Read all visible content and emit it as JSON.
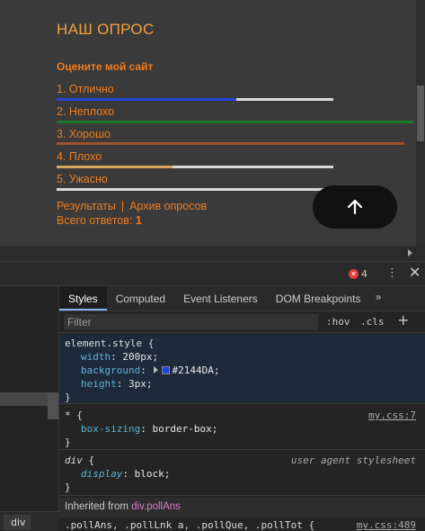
{
  "poll": {
    "title": "НАШ ОПРОС",
    "question": "Оцените мой сайт",
    "answers": [
      {
        "label": "1. Отлично",
        "fraction": 0.65,
        "color": "#2144DA"
      },
      {
        "label": "2. Неплохо",
        "fraction": 1.0,
        "color": "#1a7a2a"
      },
      {
        "label": "3. Хорошо",
        "fraction": 1.0,
        "color": "#a0522d"
      },
      {
        "label": "4. Плохо",
        "fraction": 0.42,
        "color": "#d9a55a"
      },
      {
        "label": "5. Ужасно",
        "fraction": 0.0,
        "color": "#d8d8d8"
      }
    ],
    "results_link": "Результаты",
    "separator": "|",
    "archive_link": "Архив опросов",
    "total_label": "Всего ответов: ",
    "total_value": "1"
  },
  "devtools": {
    "error_count": "4",
    "tabs": [
      "Styles",
      "Computed",
      "Event Listeners",
      "DOM Breakpoints"
    ],
    "more_tabs": "»",
    "filter_placeholder": "Filter",
    "hov": ":hov",
    "cls": ".cls",
    "add": "+",
    "element_style": {
      "selector": "element.style {",
      "width_prop": "width",
      "width_val": "200px;",
      "bg_prop": "background",
      "bg_val": "#2144DA;",
      "height_prop": "height",
      "height_val": "3px;",
      "close": "}"
    },
    "star_rule": {
      "selector": "* {",
      "source": "my.css:7",
      "prop": "box-sizing",
      "val": "border-box;",
      "close": "}"
    },
    "div_rule": {
      "selector": "div",
      "brace": " {",
      "source": "user agent stylesheet",
      "prop": "display",
      "val": "block;",
      "close": "}"
    },
    "inherited_label": "Inherited from ",
    "inherited_class": "div.pollAns",
    "last_rule_selector": ".pollAns, .pollLnk a, .pollQue, .pollTot {",
    "last_rule_source": "my.css:489",
    "breadcrumb": "div",
    "colon": ": ",
    "error_glyph": "✕"
  }
}
